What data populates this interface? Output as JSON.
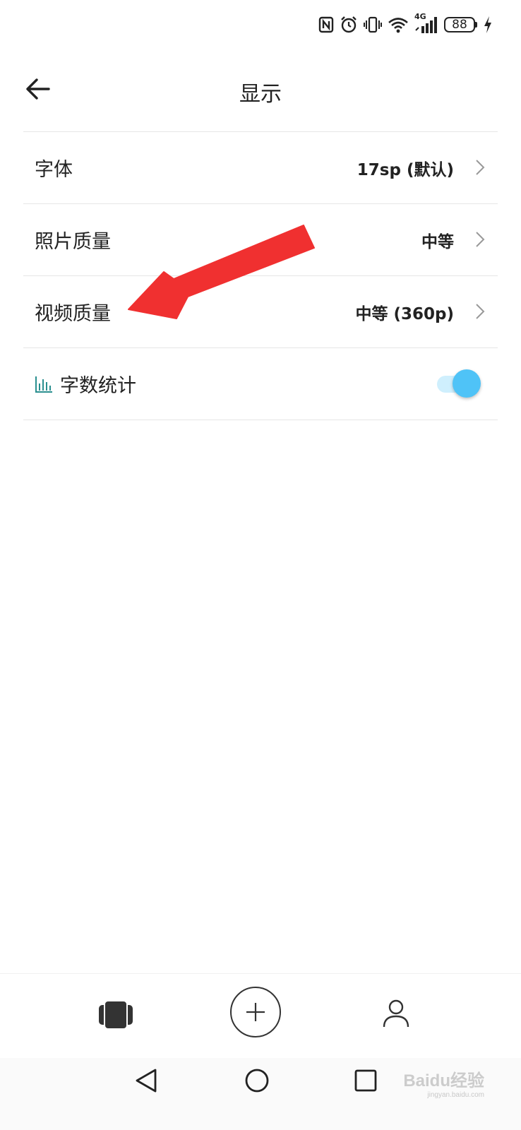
{
  "status_bar": {
    "battery_level": "88",
    "network": "4G",
    "icons": [
      "nfc-icon",
      "alarm-icon",
      "vibrate-icon",
      "wifi-icon",
      "signal-icon",
      "battery-icon",
      "charging-icon"
    ]
  },
  "header": {
    "title": "显示",
    "back_icon": "back-arrow-icon"
  },
  "settings": [
    {
      "label": "字体",
      "value": "17sp (默认)"
    },
    {
      "label": "照片质量",
      "value": "中等"
    },
    {
      "label": "视频质量",
      "value": "中等 (360p)"
    },
    {
      "label": "字数统计",
      "icon": "bar-chart-icon",
      "toggle_on": true
    }
  ],
  "bottom_nav": {
    "items": [
      "notes-icon",
      "add-icon",
      "profile-icon"
    ]
  },
  "system_nav": {
    "items": [
      "back-triangle-icon",
      "home-circle-icon",
      "recents-square-icon"
    ]
  },
  "watermark": {
    "text": "Baidu经验",
    "subtext": "jingyan.baidu.com"
  },
  "colors": {
    "accent": "#4fc3f7",
    "toggle_track": "#cfeffd",
    "annotation_arrow": "#f03030",
    "chart_icon": "#2a8f8f",
    "divider": "#e6e6e6"
  }
}
